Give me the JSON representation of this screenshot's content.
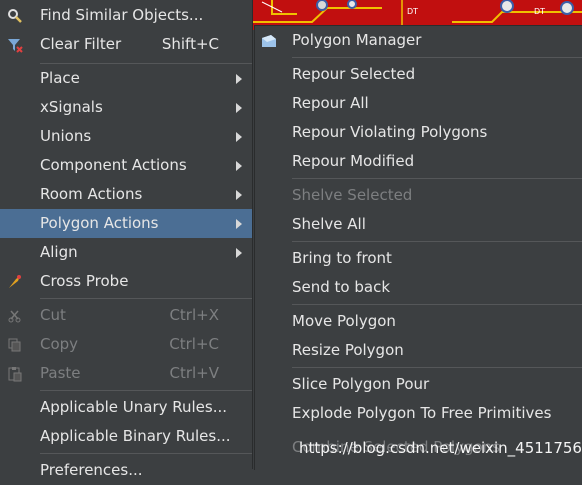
{
  "main_menu": {
    "items": [
      {
        "label": "Find Similar Objects...",
        "icon": "magnifier-icon"
      },
      {
        "label": "Clear Filter",
        "shortcut": "Shift+C",
        "icon": "funnel-clear-icon"
      },
      {
        "label": "Place",
        "submenu": true
      },
      {
        "label": "xSignals",
        "submenu": true
      },
      {
        "label": "Unions",
        "submenu": true
      },
      {
        "label": "Component Actions",
        "submenu": true
      },
      {
        "label": "Room Actions",
        "submenu": true
      },
      {
        "label": "Polygon Actions",
        "submenu": true,
        "active": true
      },
      {
        "label": "Align",
        "submenu": true
      },
      {
        "label": "Cross Probe",
        "icon": "cross-probe-icon"
      },
      {
        "label": "Cut",
        "shortcut": "Ctrl+X",
        "disabled": true,
        "icon": "scissors-icon"
      },
      {
        "label": "Copy",
        "shortcut": "Ctrl+C",
        "disabled": true,
        "icon": "copy-icon"
      },
      {
        "label": "Paste",
        "shortcut": "Ctrl+V",
        "disabled": true,
        "icon": "paste-icon"
      },
      {
        "label": "Applicable Unary Rules..."
      },
      {
        "label": "Applicable Binary Rules..."
      },
      {
        "label": "Preferences..."
      }
    ]
  },
  "sub_menu": {
    "items": [
      {
        "label": "Polygon Manager",
        "icon": "polygon-manager-icon"
      },
      {
        "label": "Repour Selected"
      },
      {
        "label": "Repour All"
      },
      {
        "label": "Repour Violating Polygons"
      },
      {
        "label": "Repour Modified"
      },
      {
        "label": "Shelve Selected",
        "disabled": true
      },
      {
        "label": "Shelve All"
      },
      {
        "label": "Bring to front"
      },
      {
        "label": "Send to back"
      },
      {
        "label": "Move Polygon"
      },
      {
        "label": "Resize Polygon"
      },
      {
        "label": "Slice Polygon Pour"
      },
      {
        "label": "Explode Polygon To Free Primitives"
      },
      {
        "label": "Combine Selected Polygons",
        "disabled": true
      }
    ]
  },
  "pcb_labels": [
    "DT",
    "DT"
  ],
  "watermark": "https://blog.csdn.net/weixin_45117564",
  "colors": {
    "menu_bg": "#3c3f41",
    "highlight": "#4b6e94",
    "text": "#e6e6e6",
    "disabled_text": "#7d7f81",
    "pcb_red": "#c10f0f"
  }
}
